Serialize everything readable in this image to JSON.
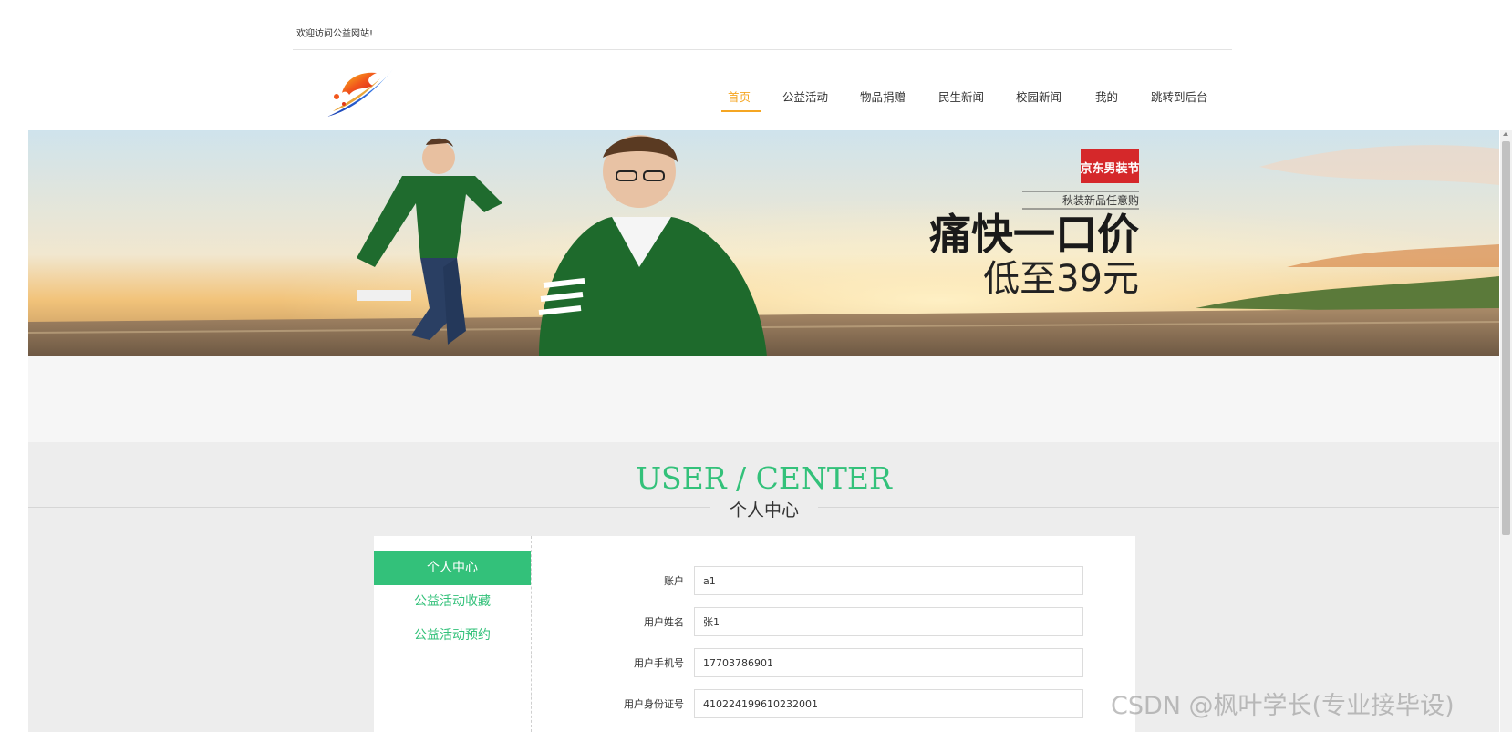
{
  "header": {
    "welcome_text": "欢迎访问公益网站!",
    "logo_icon": "flame-swoosh-logo-icon"
  },
  "nav": {
    "items": [
      {
        "label": "首页",
        "active": true
      },
      {
        "label": "公益活动"
      },
      {
        "label": "物品捐赠"
      },
      {
        "label": "民生新闻"
      },
      {
        "label": "校园新闻"
      },
      {
        "label": "我的"
      },
      {
        "label": "跳转到后台"
      }
    ],
    "active_color": "#f5a623"
  },
  "banner": {
    "brand_badge": "京东男装节",
    "tagline": "秋装新品任意购",
    "headline": "痛快一口价",
    "price_text": "低至39元"
  },
  "section": {
    "title_en": "USER / CENTER",
    "title_cn": "个人中心",
    "accent_color": "#33c17a"
  },
  "sidebar": {
    "items": [
      {
        "label": "个人中心",
        "active": true
      },
      {
        "label": "公益活动收藏"
      },
      {
        "label": "公益活动预约"
      }
    ]
  },
  "form": {
    "fields": [
      {
        "label": "账户",
        "value": "a1"
      },
      {
        "label": "用户姓名",
        "value": "张1"
      },
      {
        "label": "用户手机号",
        "value": "17703786901"
      },
      {
        "label": "用户身份证号",
        "value": "410224199610232001"
      }
    ]
  },
  "watermark": "CSDN @枫叶学长(专业接毕设)"
}
